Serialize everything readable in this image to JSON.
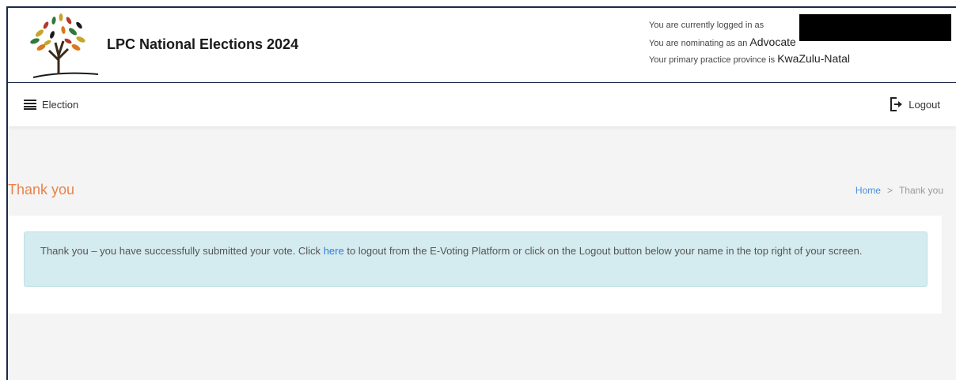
{
  "header": {
    "site_title": "LPC National Elections 2024",
    "logged_in_prefix": "You are currently logged in as",
    "nominating_prefix": "You are nominating as an",
    "nominating_role": "Advocate",
    "province_prefix": "Your primary practice province is",
    "province": "KwaZulu-Natal"
  },
  "menubar": {
    "menu_label": "Election",
    "menu_icon": "hamburger-icon",
    "logout_label": "Logout",
    "logout_icon": "logout-icon"
  },
  "page": {
    "title": "Thank you",
    "breadcrumb": {
      "home": "Home",
      "separator": ">",
      "current": "Thank you"
    }
  },
  "alert": {
    "text_before_link": "Thank you – you have successfully submitted your vote. Click",
    "link_text": "here",
    "text_after_link": "to logout from the E-Voting Platform or click on the Logout button below your name in the top right of your screen."
  },
  "colors": {
    "title_orange": "#e8824d",
    "link_blue": "#2f7ed8",
    "alert_bg": "#d4ebef",
    "frame_border": "#1b2a4a"
  }
}
